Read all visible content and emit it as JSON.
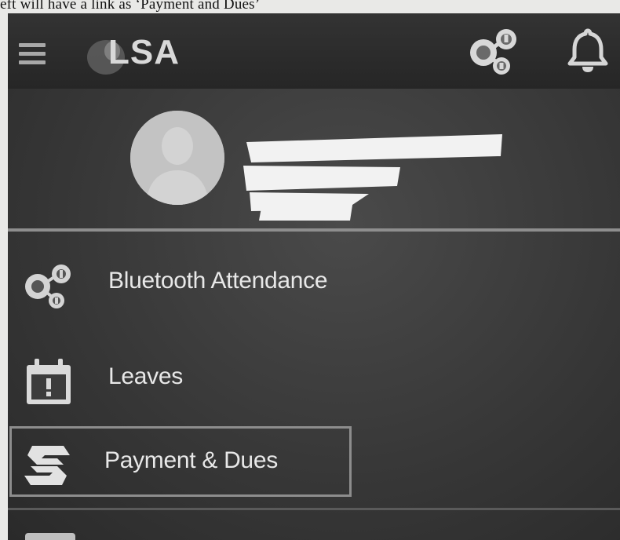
{
  "document": {
    "caption": "eft will have a link as ‘Payment and Dues’"
  },
  "app": {
    "logo": "LSA",
    "icons": {
      "menu": "hamburger-icon",
      "bluetooth_attendance": "bluetooth-attendance-icon",
      "notifications": "bell-icon"
    }
  },
  "profile": {
    "avatar": "avatar-placeholder"
  },
  "menu": {
    "items": [
      {
        "label": "Bluetooth Attendance",
        "icon": "bluetooth-attendance-icon"
      },
      {
        "label": "Leaves",
        "icon": "calendar-alert-icon"
      },
      {
        "label": "Payment & Dues",
        "icon": "payment-dues-icon"
      }
    ]
  },
  "colors": {
    "drawer_background": "#3a3a3a",
    "topbar_background": "#2b2b2b",
    "text": "#e8e8e8",
    "selected_border": "#8d8d8d"
  }
}
